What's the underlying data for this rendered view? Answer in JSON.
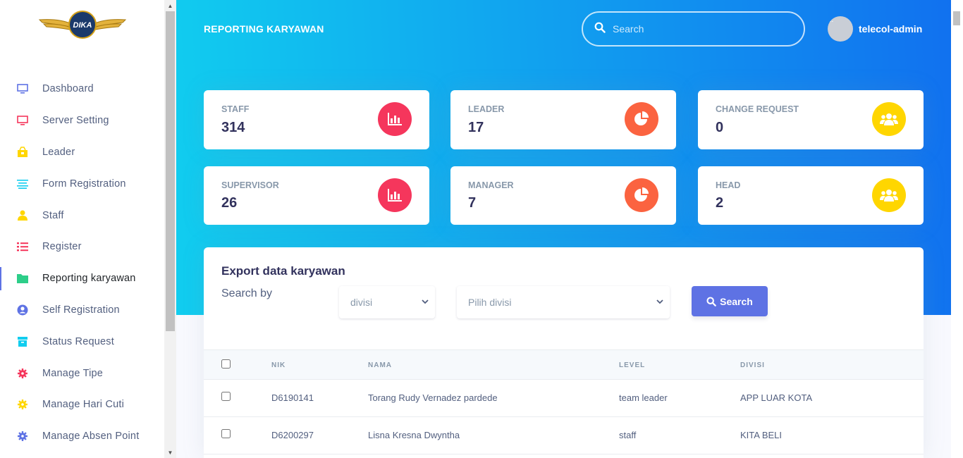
{
  "brand": {
    "logo_text": "DIKA",
    "logo_color": "#1b3a6b",
    "wing_color": "#d4a017"
  },
  "sidebar": {
    "items": [
      {
        "label": "Dashboard",
        "icon": "monitor-icon",
        "color": "#5e72e4"
      },
      {
        "label": "Server Setting",
        "icon": "monitor-icon",
        "color": "#f5365c"
      },
      {
        "label": "Leader",
        "icon": "leader-icon",
        "color": "#ffd600"
      },
      {
        "label": "Form Registration",
        "icon": "align-left-icon",
        "color": "#11cdef"
      },
      {
        "label": "Staff",
        "icon": "user-icon",
        "color": "#ffd600"
      },
      {
        "label": "Register",
        "icon": "list-icon",
        "color": "#f5365c"
      },
      {
        "label": "Reporting karyawan",
        "icon": "folder-icon",
        "color": "#2dce89"
      },
      {
        "label": "Self Registration",
        "icon": "user-circle-icon",
        "color": "#5e72e4"
      },
      {
        "label": "Status Request",
        "icon": "archive-icon",
        "color": "#11cdef"
      },
      {
        "label": "Manage Tipe",
        "icon": "gear-icon",
        "color": "#f5365c"
      },
      {
        "label": "Manage Hari Cuti",
        "icon": "gear-icon",
        "color": "#ffd600"
      },
      {
        "label": "Manage Absen Point",
        "icon": "gear-icon",
        "color": "#5e72e4"
      }
    ],
    "active_index": 6
  },
  "header": {
    "title": "REPORTING KARYAWAN",
    "search_placeholder": "Search",
    "user_name": "telecol-admin",
    "avatar_alt": "..."
  },
  "stats": [
    {
      "label": "STAFF",
      "value": "314",
      "icon": "chart-bar-icon",
      "color": "#f5365c"
    },
    {
      "label": "LEADER",
      "value": "17",
      "icon": "chart-pie-icon",
      "color": "#fb6340"
    },
    {
      "label": "CHANGE REQUEST",
      "value": "0",
      "icon": "users-icon",
      "color": "#ffd600"
    },
    {
      "label": "SUPERVISOR",
      "value": "26",
      "icon": "chart-bar-icon",
      "color": "#f5365c"
    },
    {
      "label": "MANAGER",
      "value": "7",
      "icon": "chart-pie-icon",
      "color": "#fb6340"
    },
    {
      "label": "HEAD",
      "value": "2",
      "icon": "users-icon",
      "color": "#ffd600"
    }
  ],
  "export": {
    "title": "Export data karyawan",
    "search_by_label": "Search by",
    "filter_type_value": "divisi",
    "filter_value_placeholder": "Pilih divisi",
    "search_button": "Search"
  },
  "table": {
    "columns": [
      "NIK",
      "NAMA",
      "LEVEL",
      "DIVISI"
    ],
    "rows": [
      {
        "nik": "D6190141",
        "nama": "Torang Rudy Vernadez pardede",
        "level": "team leader",
        "divisi": "APP LUAR KOTA"
      },
      {
        "nik": "D6200297",
        "nama": "Lisna Kresna Dwyntha",
        "level": "staff",
        "divisi": "KITA BELI"
      }
    ]
  }
}
